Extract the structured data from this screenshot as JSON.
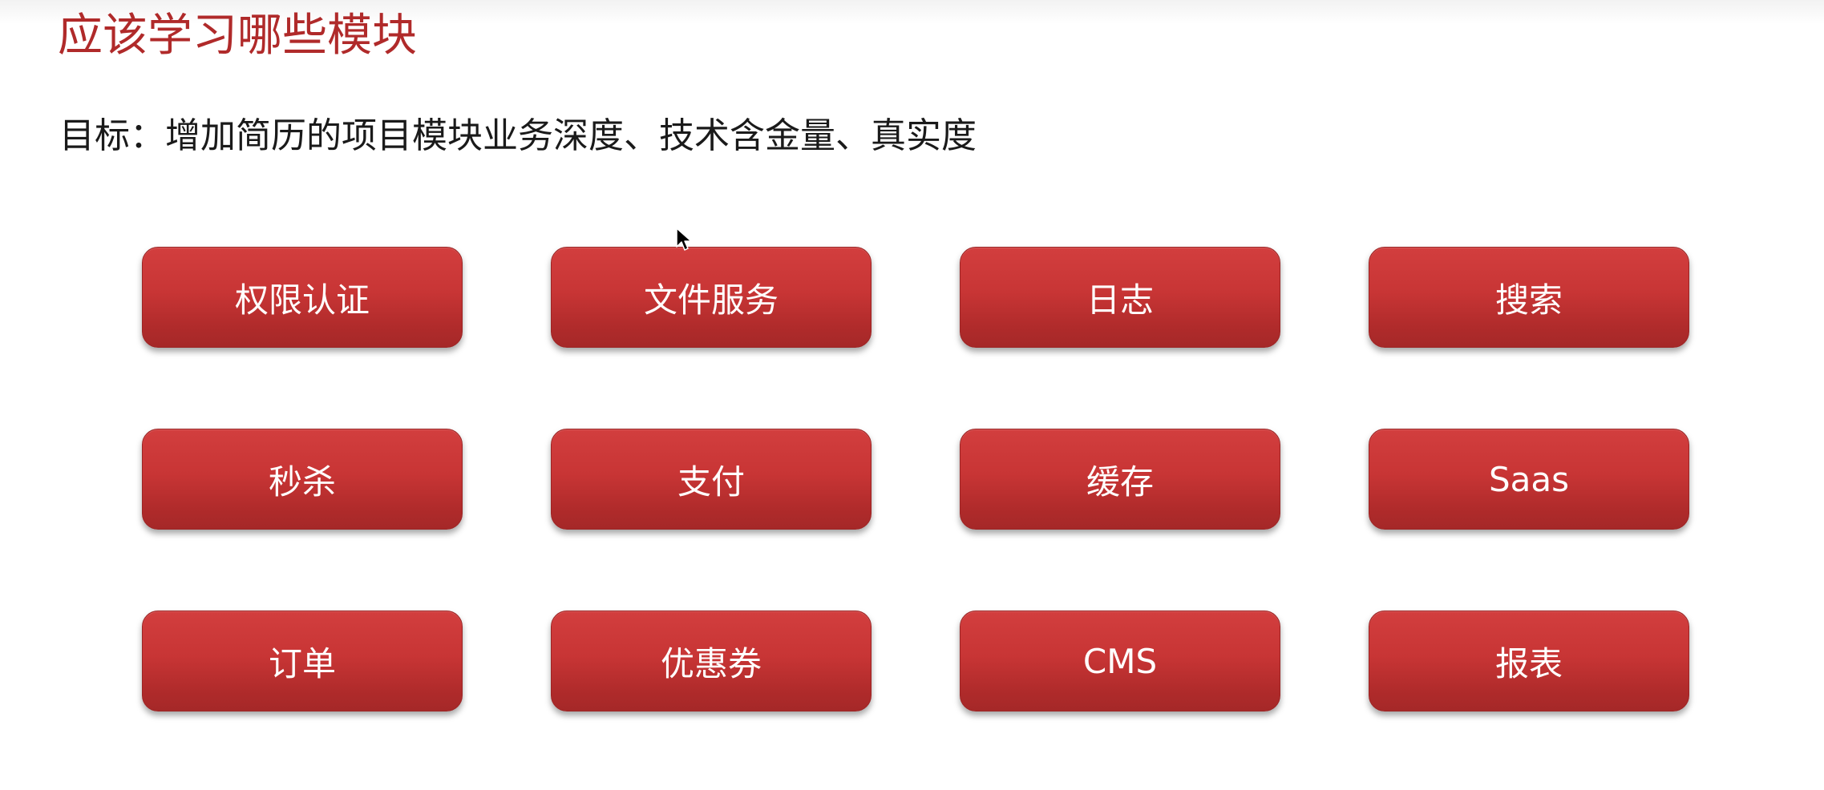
{
  "slide": {
    "title": "应该学习哪些模块",
    "goal": "目标：增加简历的项目模块业务深度、技术含金量、真实度"
  },
  "modules": [
    {
      "label": "权限认证"
    },
    {
      "label": "文件服务"
    },
    {
      "label": "日志"
    },
    {
      "label": "搜索"
    },
    {
      "label": "秒杀"
    },
    {
      "label": "支付"
    },
    {
      "label": "缓存"
    },
    {
      "label": "Saas"
    },
    {
      "label": "订单"
    },
    {
      "label": "优惠券"
    },
    {
      "label": "CMS"
    },
    {
      "label": "报表"
    }
  ],
  "colors": {
    "title": "#b02a2a",
    "button_fill": "#c83535",
    "button_text": "#ffffff",
    "goal_text": "#1a1a1a"
  },
  "icons": {
    "cursor": "mouse-pointer-icon"
  }
}
